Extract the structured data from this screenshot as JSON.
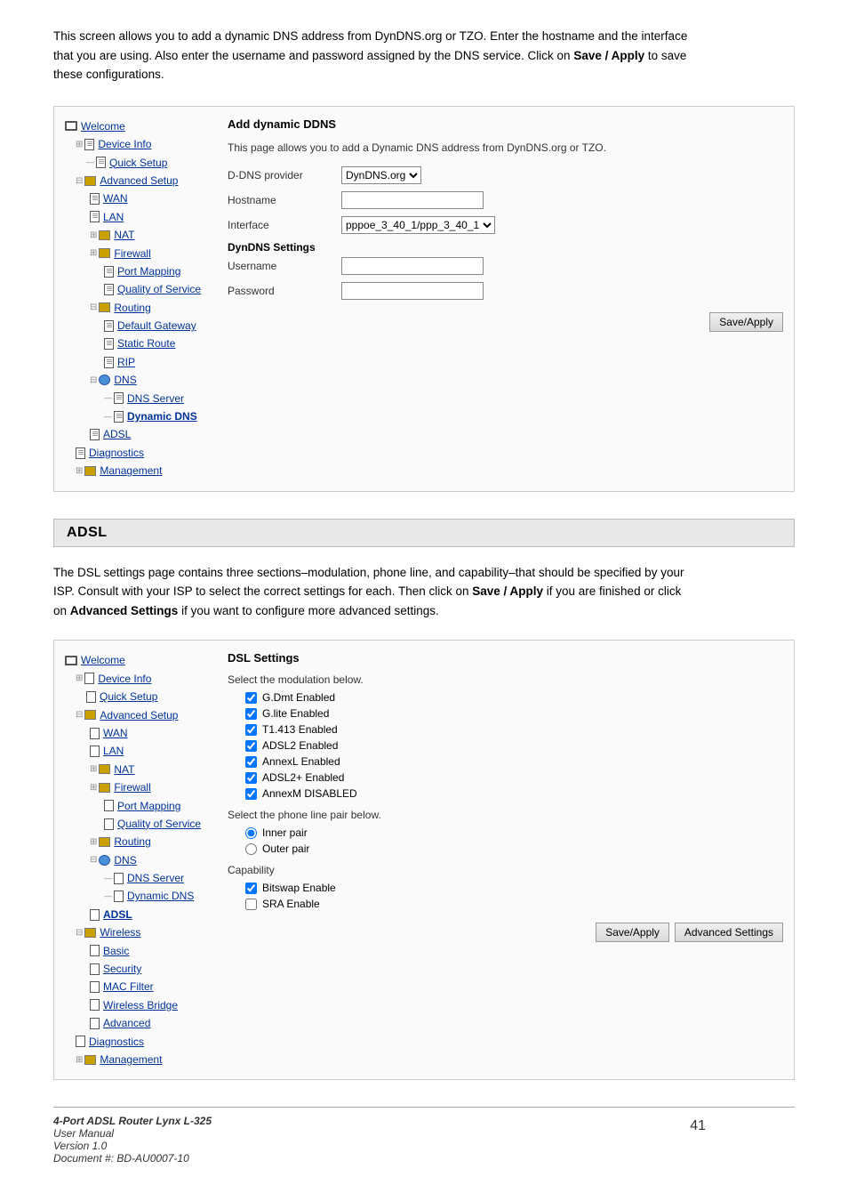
{
  "intro": {
    "text1": "This screen allows you to add a dynamic DNS address from DynDNS.org or TZO.  Enter the hostname and the interface that you are using.  Also enter the username and password assigned by the DNS service.  Click on ",
    "bold1": "Save / Apply",
    "text2": " to save these configurations."
  },
  "panel1": {
    "title": "Add dynamic DDNS",
    "desc": "This page allows you to add a Dynamic DNS address from DynDNS.org or TZO.",
    "ddns_provider_label": "D-DNS provider",
    "ddns_provider_value": "DynDNS.org",
    "hostname_label": "Hostname",
    "interface_label": "Interface",
    "interface_value": "pppoe_3_40_1/ppp_3_40_1",
    "dyndns_settings_label": "DynDNS Settings",
    "username_label": "Username",
    "password_label": "Password",
    "save_btn": "Save/Apply"
  },
  "nav1": {
    "items": [
      {
        "level": 1,
        "icon": "monitor",
        "label": "Welcome",
        "link": true
      },
      {
        "level": 2,
        "icon": "folder",
        "label": "Device Info",
        "link": true,
        "expanded": true
      },
      {
        "level": 3,
        "icon": "page",
        "label": "Quick Setup",
        "link": true
      },
      {
        "level": 2,
        "icon": "folder",
        "label": "Advanced Setup",
        "link": true,
        "expanded": true
      },
      {
        "level": 3,
        "icon": "page",
        "label": "WAN",
        "link": true
      },
      {
        "level": 3,
        "icon": "page",
        "label": "LAN",
        "link": true
      },
      {
        "level": 3,
        "icon": "folder",
        "label": "NAT",
        "link": true,
        "expanded": true
      },
      {
        "level": 3,
        "icon": "folder",
        "label": "Firewall",
        "link": true,
        "expanded": true
      },
      {
        "level": 4,
        "icon": "page",
        "label": "Port Mapping",
        "link": true
      },
      {
        "level": 4,
        "icon": "page",
        "label": "Quality of Service",
        "link": true
      },
      {
        "level": 3,
        "icon": "folder",
        "label": "Routing",
        "link": true,
        "expanded": true
      },
      {
        "level": 4,
        "icon": "page",
        "label": "Default Gateway",
        "link": true
      },
      {
        "level": 4,
        "icon": "page",
        "label": "Static Route",
        "link": true
      },
      {
        "level": 4,
        "icon": "page",
        "label": "RIP",
        "link": true
      },
      {
        "level": 3,
        "icon": "folder",
        "label": "DNS",
        "link": true,
        "expanded": true
      },
      {
        "level": 4,
        "icon": "page",
        "label": "DNS Server",
        "link": true
      },
      {
        "level": 4,
        "icon": "page",
        "label": "Dynamic DNS",
        "link": true,
        "bold": true
      },
      {
        "level": 3,
        "icon": "page",
        "label": "ADSL",
        "link": true
      },
      {
        "level": 2,
        "icon": "page",
        "label": "Diagnostics",
        "link": true
      },
      {
        "level": 2,
        "icon": "folder",
        "label": "Management",
        "link": true,
        "expanded": true
      }
    ]
  },
  "adsl": {
    "header": "ADSL",
    "intro_text1": "The DSL settings page contains three sections–modulation, phone line, and capability–that should be specified by your ISP.  Consult with your ISP to select the correct settings for each.  Then click on ",
    "bold1": "Save / Apply",
    "intro_text2": " if you are finished or click on ",
    "bold2": "Advanced Settings",
    "intro_text3": " if you want to configure more advanced settings."
  },
  "dsl_panel": {
    "title": "DSL Settings",
    "modulation_label": "Select the modulation below.",
    "modulation_items": [
      {
        "label": "G.Dmt Enabled",
        "checked": true
      },
      {
        "label": "G.lite Enabled",
        "checked": true
      },
      {
        "label": "T1.413 Enabled",
        "checked": true
      },
      {
        "label": "ADSL2 Enabled",
        "checked": true
      },
      {
        "label": "AnnexL Enabled",
        "checked": true
      },
      {
        "label": "ADSL2+ Enabled",
        "checked": true
      },
      {
        "label": "AnnexM DISABLED",
        "checked": true
      }
    ],
    "phone_line_label": "Select the phone line pair below.",
    "phone_line_items": [
      {
        "label": "Inner pair",
        "checked": true
      },
      {
        "label": "Outer pair",
        "checked": false
      }
    ],
    "capability_label": "Capability",
    "capability_items": [
      {
        "label": "Bitswap Enable",
        "checked": true
      },
      {
        "label": "SRA Enable",
        "checked": false
      }
    ],
    "save_btn": "Save/Apply",
    "advanced_btn": "Advanced Settings"
  },
  "nav2": {
    "items": [
      {
        "level": 1,
        "icon": "monitor",
        "label": "Welcome",
        "link": true
      },
      {
        "level": 2,
        "icon": "folder",
        "label": "Device Info",
        "link": true,
        "expanded": true
      },
      {
        "level": 3,
        "icon": "page",
        "label": "Quick Setup",
        "link": true
      },
      {
        "level": 2,
        "icon": "folder",
        "label": "Advanced Setup",
        "link": true,
        "expanded": true
      },
      {
        "level": 3,
        "icon": "page",
        "label": "WAN",
        "link": true
      },
      {
        "level": 3,
        "icon": "page",
        "label": "LAN",
        "link": true
      },
      {
        "level": 3,
        "icon": "folder",
        "label": "NAT",
        "link": true,
        "expanded": true
      },
      {
        "level": 3,
        "icon": "folder",
        "label": "Firewall",
        "link": true,
        "expanded": true
      },
      {
        "level": 4,
        "icon": "page",
        "label": "Port Mapping",
        "link": true
      },
      {
        "level": 4,
        "icon": "page",
        "label": "Quality of Service",
        "link": true
      },
      {
        "level": 3,
        "icon": "folder",
        "label": "Routing",
        "link": true,
        "expanded": true
      },
      {
        "level": 3,
        "icon": "folder",
        "label": "DNS",
        "link": true,
        "expanded": true
      },
      {
        "level": 4,
        "icon": "page",
        "label": "DNS Server",
        "link": true
      },
      {
        "level": 4,
        "icon": "page",
        "label": "Dynamic DNS",
        "link": true
      },
      {
        "level": 3,
        "icon": "page",
        "label": "ADSL",
        "link": true,
        "bold": true
      },
      {
        "level": 2,
        "icon": "folder",
        "label": "Wireless",
        "link": true,
        "expanded": true
      },
      {
        "level": 3,
        "icon": "page",
        "label": "Basic",
        "link": true
      },
      {
        "level": 3,
        "icon": "page",
        "label": "Security",
        "link": true
      },
      {
        "level": 3,
        "icon": "page",
        "label": "MAC Filter",
        "link": true
      },
      {
        "level": 3,
        "icon": "page",
        "label": "Wireless Bridge",
        "link": true
      },
      {
        "level": 3,
        "icon": "page",
        "label": "Advanced",
        "link": true
      },
      {
        "level": 2,
        "icon": "page",
        "label": "Diagnostics",
        "link": true
      },
      {
        "level": 2,
        "icon": "folder",
        "label": "Management",
        "link": true,
        "expanded": true
      }
    ]
  },
  "footer": {
    "product": "4-Port ADSL Router Lynx L-325",
    "manual": "User Manual",
    "version": "Version 1.0",
    "doc": "Document #:  BD-AU0007-10",
    "page_number": "41"
  }
}
